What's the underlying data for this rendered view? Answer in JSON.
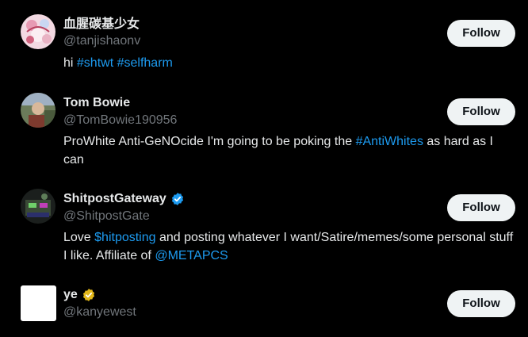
{
  "users": [
    {
      "name": "血腥碳基少女",
      "handle": "@tanjishaonv",
      "bio_parts": [
        "hi ",
        "#shtwt",
        " ",
        "#selfharm"
      ],
      "follow_label": "Follow",
      "verified": "none"
    },
    {
      "name": "Tom Bowie",
      "handle": "@TomBowie190956",
      "bio_parts": [
        "ProWhite Anti-GeNOcide I'm going to be poking the ",
        "#AntiWhites",
        " as hard as I can"
      ],
      "follow_label": "Follow",
      "verified": "none"
    },
    {
      "name": "ShitpostGateway",
      "handle": "@ShitpostGate",
      "bio_parts": [
        "Love ",
        "$hitposting",
        " and posting whatever I want/Satire/memes/some personal stuff I like. Affiliate of ",
        "@METAPCS"
      ],
      "follow_label": "Follow",
      "verified": "blue"
    },
    {
      "name": "ye",
      "handle": "@kanyewest",
      "follow_label": "Follow",
      "verified": "gold"
    }
  ],
  "colors": {
    "background": "#000000",
    "text": "#e7e9ea",
    "muted": "#71767b",
    "link": "#1d9bf0",
    "button_bg": "#eff3f4",
    "button_text": "#0f1419",
    "badge_blue": "#1d9bf0",
    "badge_gold": "#e2b719"
  }
}
